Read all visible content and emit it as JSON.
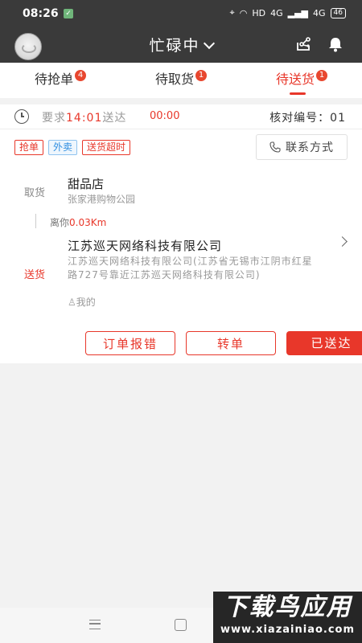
{
  "status_bar": {
    "time": "08:26",
    "network": "HD",
    "signal1": "4G",
    "signal2": "4G",
    "battery": "46"
  },
  "header": {
    "status_title": "忙碌中"
  },
  "tabs": [
    {
      "label": "待抢单",
      "badge": "4",
      "active": false
    },
    {
      "label": "待取货",
      "badge": "1",
      "active": false
    },
    {
      "label": "待送货",
      "badge": "1",
      "active": true
    }
  ],
  "order": {
    "require_prefix": "要求",
    "deadline_time": "14:01",
    "require_suffix": "送达",
    "countdown": "00:00",
    "verify_label": "核对编号：",
    "verify_number": "01",
    "tags": [
      {
        "text": "抢单",
        "style": "red"
      },
      {
        "text": "外卖",
        "style": "blue"
      },
      {
        "text": "送货超时",
        "style": "red"
      }
    ],
    "contact_label": "联系方式",
    "pickup_label": "取货",
    "shop_name": "甜品店",
    "shop_address": "张家港购物公园",
    "distance_prefix": "离你",
    "distance_value": "0.03Km",
    "deliver_label": "送货",
    "customer_name": "江苏巡天网络科技有限公司",
    "customer_address": "江苏巡天网络科技有限公司(江苏省无锡市江阴市红星路727号靠近江苏巡天网络科技有限公司)",
    "customer_person": "我的",
    "buttons": {
      "report_error": "订单报错",
      "transfer": "转单",
      "delivered": "已送达"
    }
  },
  "watermark": {
    "big": "下载鸟应用",
    "small": "www.xiazainiao.com"
  },
  "colors": {
    "accent": "#e8372a",
    "header_bg": "#3a3a3a",
    "tag_blue": "#2f8ee0"
  }
}
